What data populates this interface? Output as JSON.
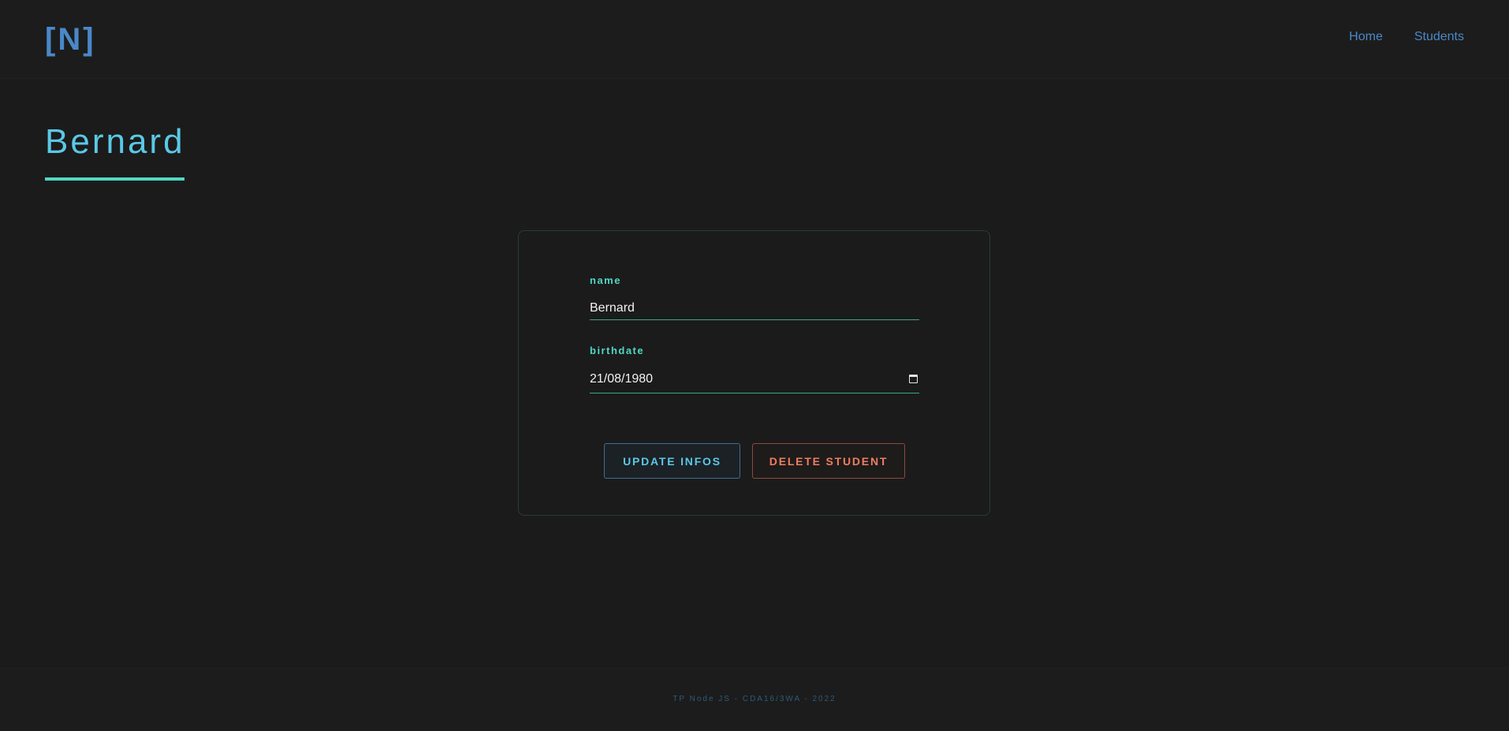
{
  "header": {
    "logo": "[N]",
    "nav": [
      {
        "label": "Home"
      },
      {
        "label": "Students"
      }
    ]
  },
  "page": {
    "title": "Bernard"
  },
  "form": {
    "name": {
      "label": "name",
      "value": "Bernard"
    },
    "birthdate": {
      "label": "birthdate",
      "value": "21/08/1980",
      "icon": "calendar-icon"
    },
    "buttons": {
      "update": "UPDATE INFOS",
      "delete": "DELETE STUDENT"
    }
  },
  "footer": {
    "text": "TP Node JS - CDA16/3WA - 2022"
  },
  "colors": {
    "accent": "#5bc8e6",
    "secondary": "#4fd8c4",
    "nav": "#4a88c8",
    "danger": "#ef7e61",
    "background": "#1b1b1b"
  }
}
